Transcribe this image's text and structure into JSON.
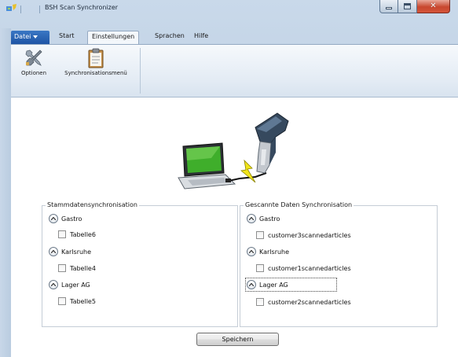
{
  "window": {
    "title": "BSH Scan Synchronizer",
    "controls": [
      "minimize",
      "maximize",
      "close"
    ]
  },
  "ribbon": {
    "file_tab": "Datei",
    "tabs": [
      {
        "label": "Start",
        "active": false
      },
      {
        "label": "Einstellungen",
        "active": true
      },
      {
        "label": "Sprachen",
        "active": false
      },
      {
        "label": "Hilfe",
        "active": false
      }
    ],
    "buttons": [
      {
        "label": "Optionen",
        "icon": "tools-icon"
      },
      {
        "label": "Synchronisationsmenü",
        "icon": "clipboard-icon"
      }
    ]
  },
  "illustration": {
    "icons": [
      "laptop-icon",
      "lightning-icon",
      "barcode-scanner-icon"
    ]
  },
  "master_data": {
    "title": "Stammdatensynchronisation",
    "groups": [
      {
        "name": "Gastro",
        "items": [
          {
            "label": "Tabelle6",
            "checked": false
          }
        ]
      },
      {
        "name": "Karlsruhe",
        "items": [
          {
            "label": "Tabelle4",
            "checked": false
          }
        ]
      },
      {
        "name": "Lager AG",
        "items": [
          {
            "label": "Tabelle5",
            "checked": false
          }
        ]
      }
    ]
  },
  "scanned_data": {
    "title": "Gescannte Daten Synchronisation",
    "groups": [
      {
        "name": "Gastro",
        "items": [
          {
            "label": "customer3scannedarticles",
            "checked": false
          }
        ]
      },
      {
        "name": "Karlsruhe",
        "items": [
          {
            "label": "customer1scannedarticles",
            "checked": false
          }
        ]
      },
      {
        "name": "Lager AG",
        "items": [
          {
            "label": "customer2scannedarticles",
            "checked": false
          }
        ]
      }
    ]
  },
  "actions": {
    "save_label": "Speichern"
  },
  "colors": {
    "accent": "#1f55a5",
    "close_button": "#c8472f",
    "laptop_screen": "#3fae2b",
    "lightning": "#f1e51a"
  }
}
